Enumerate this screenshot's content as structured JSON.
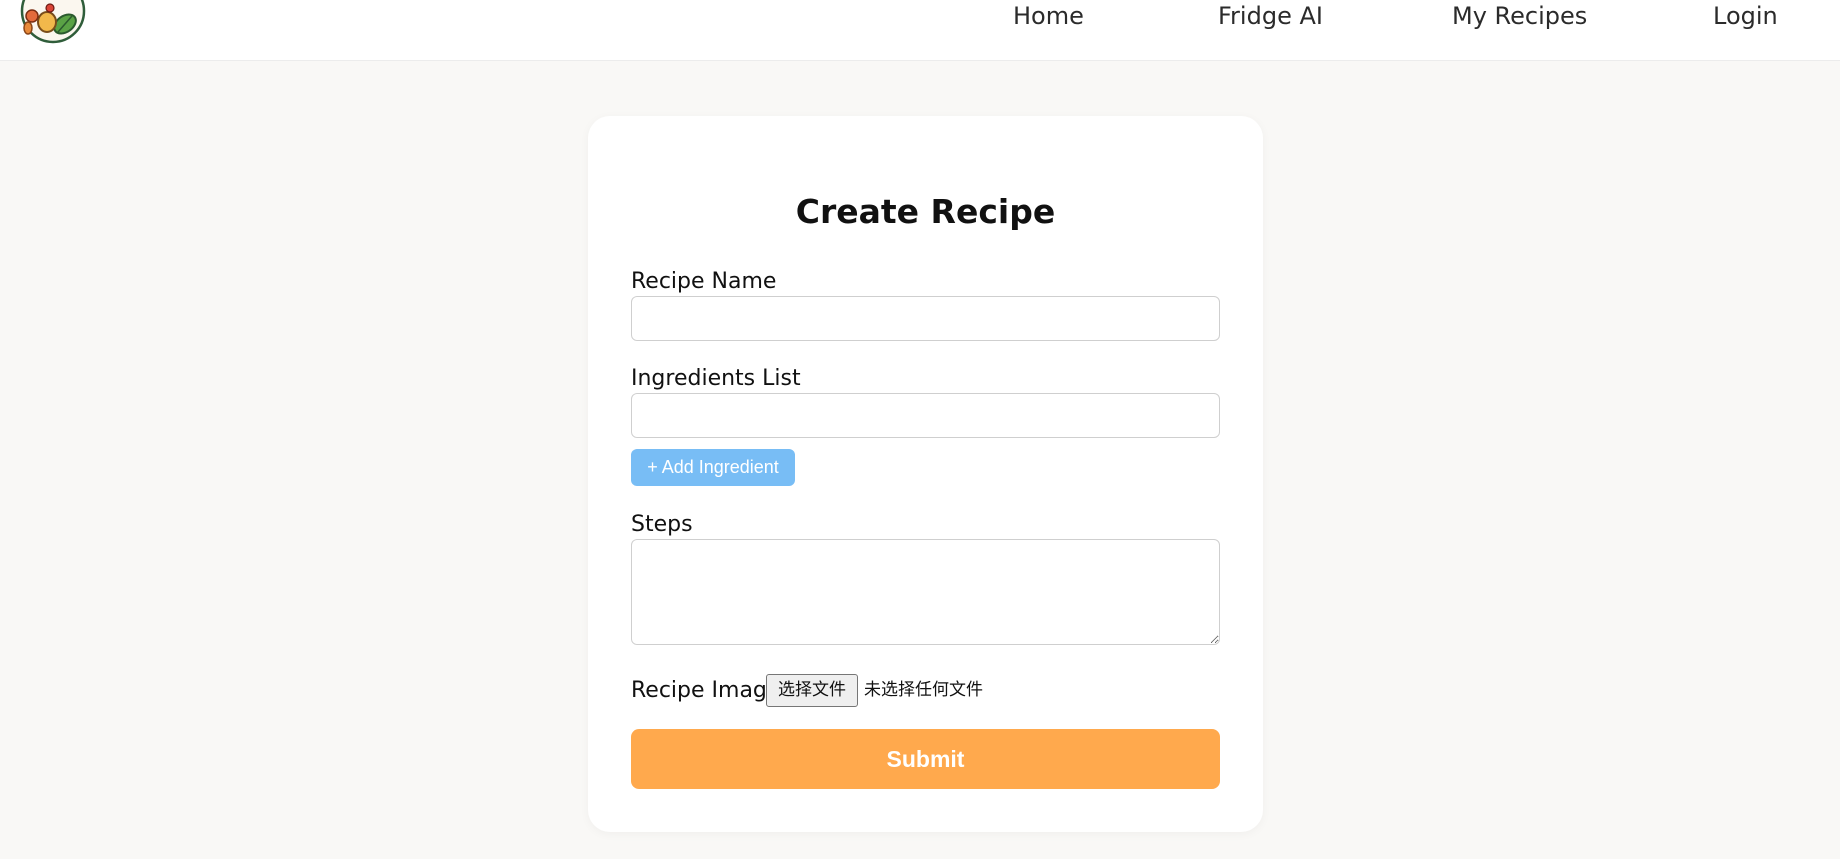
{
  "header": {
    "nav": [
      {
        "label": "Home"
      },
      {
        "label": "Fridge AI"
      },
      {
        "label": "My Recipes"
      },
      {
        "label": "Login"
      }
    ]
  },
  "form": {
    "title": "Create Recipe",
    "recipe_name": {
      "label": "Recipe Name",
      "value": ""
    },
    "ingredients": {
      "label": "Ingredients List",
      "value": "",
      "add_button": "+ Add Ingredient"
    },
    "steps": {
      "label": "Steps",
      "value": ""
    },
    "image": {
      "label": "Recipe Image",
      "choose_button": "选择文件",
      "status": "未选择任何文件"
    },
    "submit": "Submit"
  },
  "colors": {
    "background": "#f9f8f6",
    "add_button": "#78bdf5",
    "submit_button": "#ffa94d"
  }
}
